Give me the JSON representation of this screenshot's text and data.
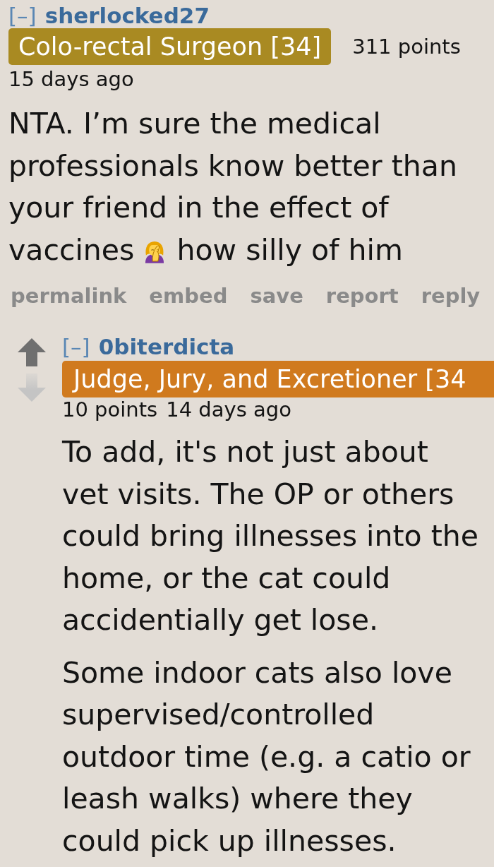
{
  "comments": [
    {
      "collapse": "[–]",
      "author": "sherlocked27",
      "flair": {
        "text": "Colo-rectal Surgeon [34]",
        "color": "#a98a22"
      },
      "points": "311 points",
      "time": "15 days ago",
      "paragraphs": [
        [
          {
            "kind": "text",
            "lines": [
              "NTA. I’m sure the medical",
              "professionals know better than",
              "your friend in the effect of",
              "vaccines"
            ]
          },
          {
            "kind": "emoji"
          },
          {
            "kind": "text",
            "lines": [
              "how silly of him"
            ]
          }
        ]
      ],
      "actions": [
        "permalink",
        "embed",
        "save",
        "report",
        "reply"
      ],
      "replies": [
        {
          "collapse": "[–]",
          "author": "0biterdicta",
          "flair": {
            "text": "Judge, Jury, and Excretioner [34",
            "color": "#d07a1e"
          },
          "points": "10 points",
          "time": "14 days ago",
          "paragraphs": [
            [
              {
                "kind": "text",
                "lines": [
                  "To add, it's not just about",
                  "vet visits. The OP or others",
                  "could bring illnesses into the",
                  "home, or the cat could",
                  "accidentially get lose."
                ]
              }
            ],
            [
              {
                "kind": "text",
                "lines": [
                  "Some indoor cats also love",
                  "supervised/controlled",
                  "outdoor time (e.g. a catio or",
                  "leash walks) where they",
                  "could pick up illnesses."
                ]
              }
            ]
          ]
        }
      ]
    }
  ]
}
